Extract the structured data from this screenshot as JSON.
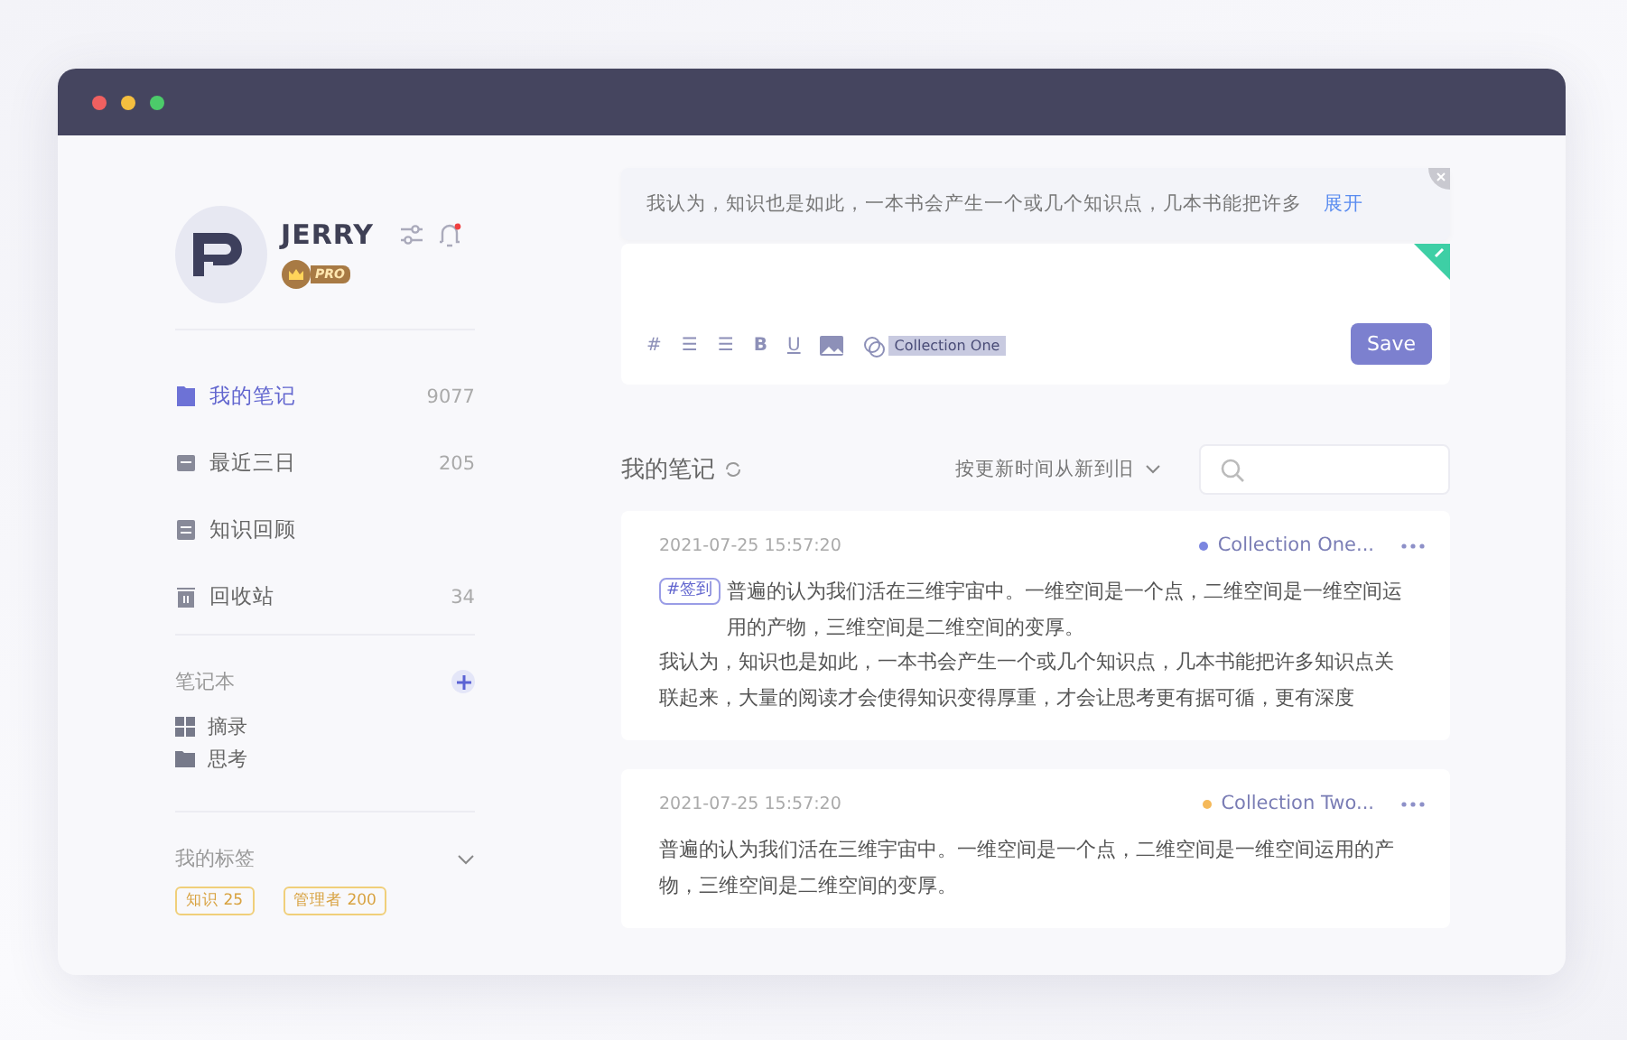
{
  "profile": {
    "name": "JERRY",
    "badge": "PRO"
  },
  "nav": [
    {
      "label": "我的笔记",
      "count": "9077",
      "selected": true
    },
    {
      "label": "最近三日",
      "count": "205",
      "selected": false
    },
    {
      "label": "知识回顾",
      "selected": false
    },
    {
      "label": "回收站",
      "count": "34",
      "selected": false
    }
  ],
  "notebooks": {
    "title": "笔记本",
    "items": [
      {
        "label": "摘录",
        "kind": "grid"
      },
      {
        "label": "思考",
        "kind": "folder"
      }
    ]
  },
  "tags": {
    "title": "我的标签",
    "items": [
      "知识 25",
      "管理者 200"
    ]
  },
  "quote": {
    "text": "我认为，知识也是如此，一本书会产生一个或几个知识点，几本书能把许多",
    "expand": "展开"
  },
  "editor": {
    "toolbar": [
      "#",
      "☰",
      "☰",
      "B",
      "U"
    ],
    "collection": "Collection One",
    "save": "Save"
  },
  "list": {
    "title": "我的笔记",
    "sort": "按更新时间从新到旧"
  },
  "notes": [
    {
      "time": "2021-07-25 15:57:20",
      "collection": "Collection One...",
      "color": "#7b86e0",
      "tag": "#签到",
      "paragraphs": [
        "普遍的认为我们活在三维宇宙中。一维空间是一个点，二维空间是一维空间运用的产物，三维空间是二维空间的变厚。",
        "我认为，知识也是如此，一本书会产生一个或几个知识点，几本书能把许多知识点关联起来，大量的阅读才会使得知识变得厚重，才会让思考更有据可循，更有深度"
      ]
    },
    {
      "time": "2021-07-25 15:57:20",
      "collection": "Collection Two...",
      "color": "#f5b95a",
      "paragraphs": [
        "普遍的认为我们活在三维宇宙中。一维空间是一个点，二维空间是一维空间运用的产物，三维空间是二维空间的变厚。"
      ]
    }
  ]
}
